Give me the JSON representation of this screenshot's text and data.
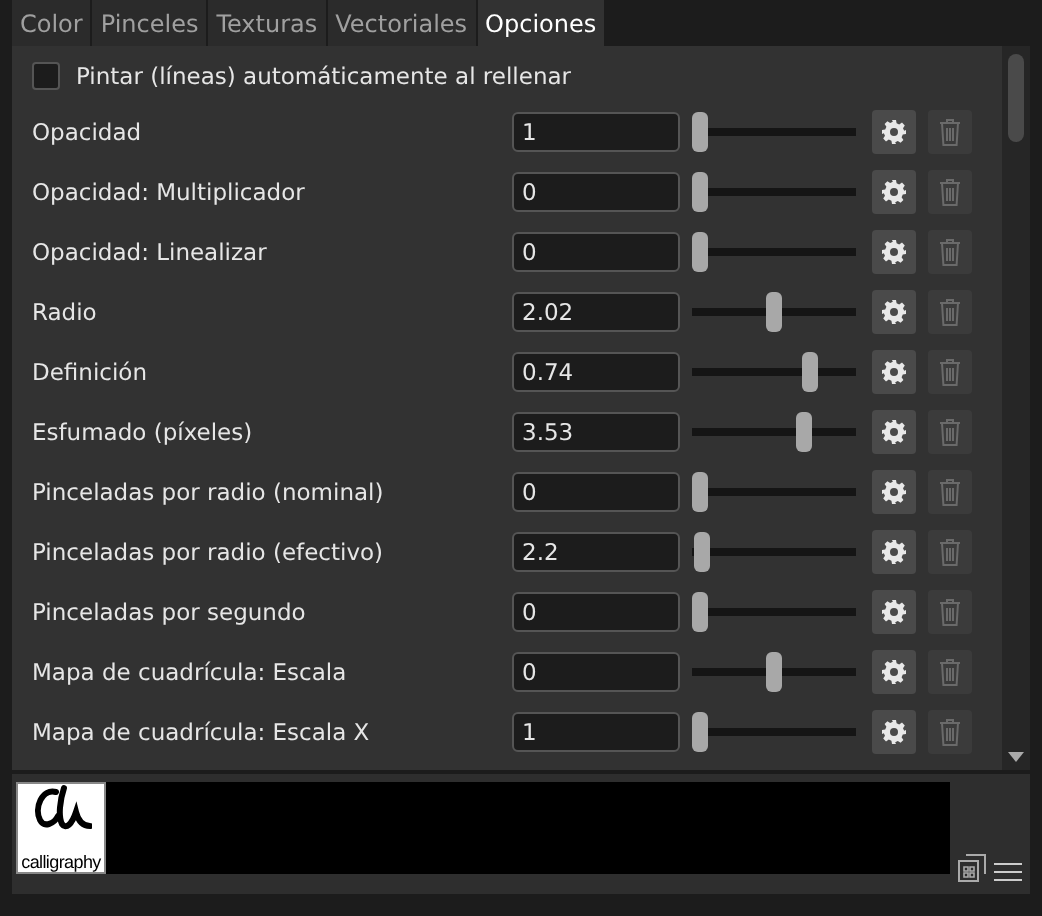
{
  "tabs": [
    {
      "label": "Color",
      "selected": false
    },
    {
      "label": "Pinceles",
      "selected": false
    },
    {
      "label": "Texturas",
      "selected": false
    },
    {
      "label": "Vectoriales",
      "selected": false
    },
    {
      "label": "Opciones",
      "selected": true
    }
  ],
  "auto_paint": {
    "label": "Pintar (líneas) automáticamente al rellenar",
    "checked": false
  },
  "options": [
    {
      "label": "Opacidad",
      "value": "1",
      "level": 0
    },
    {
      "label": "Opacidad: Multiplicador",
      "value": "0",
      "level": 0
    },
    {
      "label": "Opacidad: Linealizar",
      "value": "0",
      "level": 0
    },
    {
      "label": "Radio",
      "value": "2.02",
      "level": 0.5
    },
    {
      "label": "Definición",
      "value": "0.74",
      "level": 0.74
    },
    {
      "label": "Esfumado (píxeles)",
      "value": "3.53",
      "level": 0.7
    },
    {
      "label": "Pinceladas por radio (nominal)",
      "value": "0",
      "level": 0
    },
    {
      "label": "Pinceladas por radio (efectivo)",
      "value": "2.2",
      "level": 0.02
    },
    {
      "label": "Pinceladas por segundo",
      "value": "0",
      "level": 0
    },
    {
      "label": "Mapa de cuadrícula: Escala",
      "value": "0",
      "level": 0.5
    },
    {
      "label": "Mapa de cuadrícula: Escala X",
      "value": "1",
      "level": 0
    }
  ],
  "brush_preview": {
    "name": "calligraphy"
  }
}
